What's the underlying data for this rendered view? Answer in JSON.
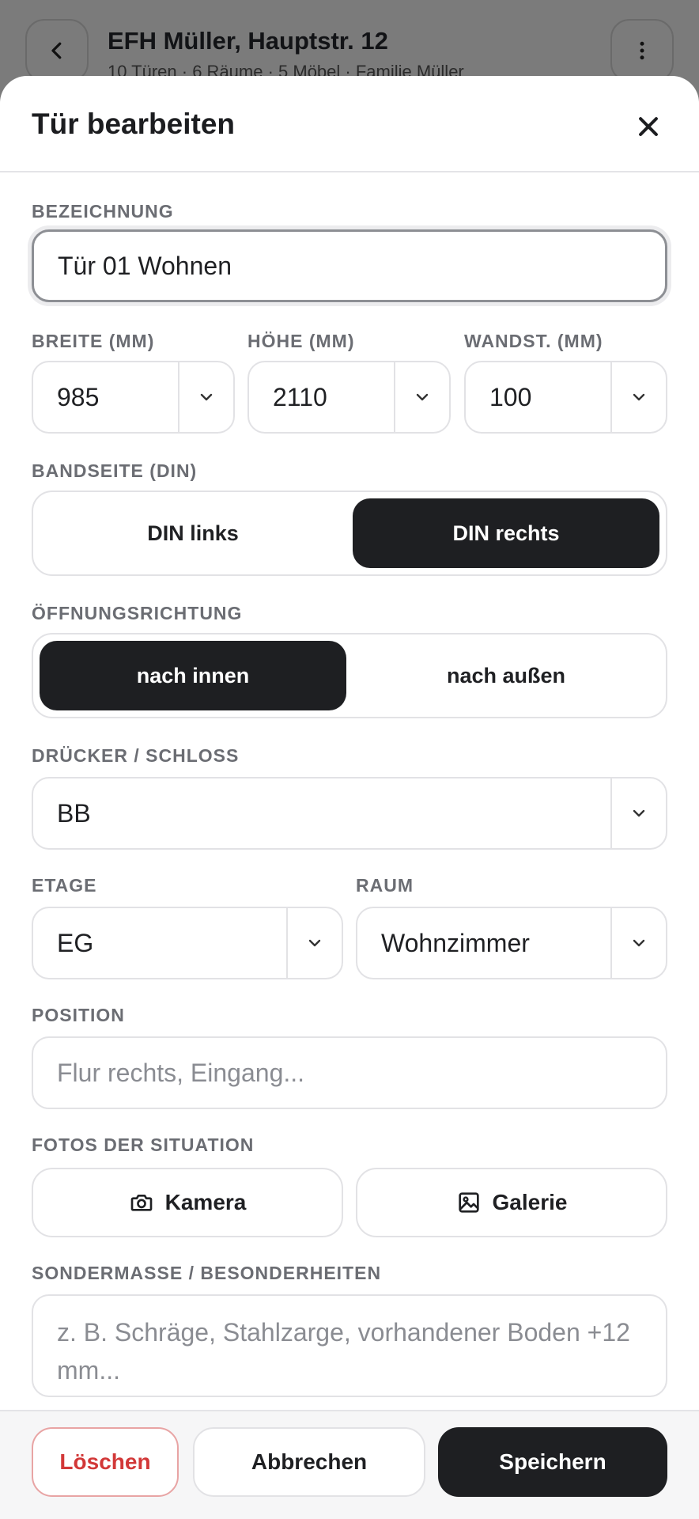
{
  "background": {
    "title": "EFH Müller, Hauptstr. 12",
    "subtitle": "10 Türen · 6 Räume · 5 Möbel · Familie Müller"
  },
  "sheet": {
    "title": "Tür bearbeiten"
  },
  "form": {
    "bezeichnung": {
      "label": "BEZEICHNUNG",
      "value": "Tür 01 Wohnen"
    },
    "breite": {
      "label": "BREITE (MM)",
      "value": "985"
    },
    "hoehe": {
      "label": "HÖHE (MM)",
      "value": "2110"
    },
    "wandst": {
      "label": "WANDST. (MM)",
      "value": "100"
    },
    "bandseite": {
      "label": "BANDSEITE (DIN)",
      "options": [
        "DIN links",
        "DIN rechts"
      ],
      "selected": "DIN rechts"
    },
    "oeffnung": {
      "label": "ÖFFNUNGSRICHTUNG",
      "options": [
        "nach innen",
        "nach außen"
      ],
      "selected": "nach innen"
    },
    "druecker": {
      "label": "DRÜCKER / SCHLOSS",
      "value": "BB"
    },
    "etage": {
      "label": "ETAGE",
      "value": "EG"
    },
    "raum": {
      "label": "RAUM",
      "value": "Wohnzimmer"
    },
    "position": {
      "label": "POSITION",
      "placeholder": "Flur rechts, Eingang..."
    },
    "fotos": {
      "label": "FOTOS DER SITUATION",
      "camera": "Kamera",
      "gallery": "Galerie"
    },
    "sonder": {
      "label": "SONDERMASSE / BESONDERHEITEN",
      "placeholder": "z. B. Schräge, Stahlzarge, vorhandener Boden +12 mm..."
    }
  },
  "footer": {
    "delete": "Löschen",
    "cancel": "Abbrechen",
    "save": "Speichern"
  },
  "colors": {
    "primary": "#1e1f22",
    "danger": "#d23838",
    "overlay": "#7b7b7b"
  }
}
